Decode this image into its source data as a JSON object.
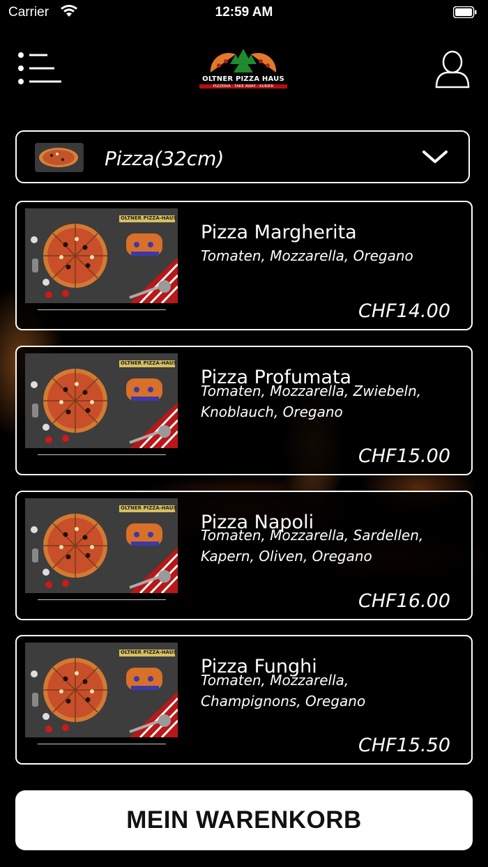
{
  "status_bar": {
    "carrier": "Carrier",
    "time": "12:59 AM"
  },
  "header": {
    "menu_icon": "hamburger-menu-icon",
    "logo_text": "OLTNER PIZZA HAUS",
    "logo_subtitle": "PIZZERIA · TAKE AWAY · KURIER",
    "user_icon": "user-profile-icon"
  },
  "category": {
    "label": "Pizza(32cm)",
    "icon": "chevron-down-icon"
  },
  "items": [
    {
      "name": "Pizza Margherita",
      "desc": [
        "Tomaten, Mozzarella, Oregano"
      ],
      "price": "CHF14.00",
      "thumb_brand": "OLTNER PIZZA-HAUS"
    },
    {
      "name": "Pizza Profumata",
      "desc": [
        "Tomaten, Mozzarella, Zwiebeln,",
        "Knoblauch, Oregano"
      ],
      "price": "CHF15.00",
      "thumb_brand": "OLTNER PIZZA-HAUS"
    },
    {
      "name": "Pizza Napoli",
      "desc": [
        "Tomaten, Mozzarella, Sardellen,",
        "Kapern, Oliven, Oregano"
      ],
      "price": "CHF16.00",
      "thumb_brand": "OLTNER PIZZA-HAUS"
    },
    {
      "name": "Pizza Funghi",
      "desc": [
        "Tomaten, Mozzarella,",
        "Champignons, Oregano"
      ],
      "price": "CHF15.50",
      "thumb_brand": "OLTNER PIZZA-HAUS"
    }
  ],
  "cart_button": {
    "label": "MEIN WARENKORB"
  },
  "colors": {
    "background": "#000000",
    "accent": "#ffffff",
    "brand_red": "#b01010"
  }
}
